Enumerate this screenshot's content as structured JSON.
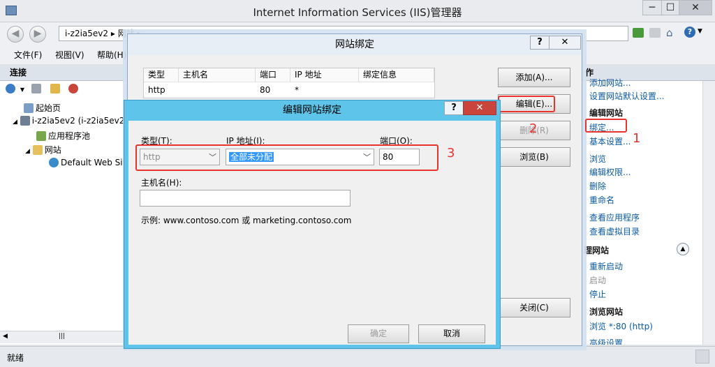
{
  "window": {
    "title": "Internet Information Services (IIS)管理器",
    "min": "─",
    "max": "☐",
    "close": "✕"
  },
  "address": {
    "path": "i-z2ia5ev2  ▸  网站  ▸",
    "back": "◀",
    "forward": "▶"
  },
  "menu": {
    "file": "文件(F)",
    "view": "视图(V)",
    "help": "帮助(H)"
  },
  "left_pane": {
    "header": "连接",
    "tree": [
      "起始页",
      "i-z2ia5ev2 (i-z2ia5ev2\\",
      "应用程序池",
      "网站",
      "Default Web Sit"
    ]
  },
  "right_pane": {
    "header_fragment": "作",
    "items": {
      "add_site": "添加网站...",
      "set_defaults": "设置网站默认设置...",
      "edit_site_header": "编辑网站",
      "bindings": "绑定...",
      "basic_settings": "基本设置...",
      "explore": "浏览",
      "edit_perms": "编辑权限...",
      "remove": "删除",
      "rename": "重命名",
      "view_apps": "查看应用程序",
      "view_vdirs": "查看虚拟目录",
      "manage_header": "理网站",
      "restart": "重新启动",
      "start": "启动",
      "stop": "停止",
      "browse_header": "浏览网站",
      "browse_80": "浏览 *:80 (http)",
      "advanced": "高级设置..."
    }
  },
  "status": {
    "text": "就绪"
  },
  "dialog_bindings": {
    "title": "网站绑定",
    "help": "?",
    "close": "✕",
    "columns": [
      "类型",
      "主机名",
      "端口",
      "IP 地址",
      "绑定信息"
    ],
    "rows": [
      {
        "type": "http",
        "host": "",
        "port": "80",
        "ip": "*",
        "info": ""
      }
    ],
    "buttons": {
      "add": "添加(A)...",
      "edit": "编辑(E)...",
      "remove": "删除(R)",
      "browse": "浏览(B)",
      "close": "关闭(C)"
    }
  },
  "dialog_edit": {
    "title": "编辑网站绑定",
    "help": "?",
    "close": "✕",
    "type_label": "类型(T):",
    "type_value": "http",
    "ip_label": "IP 地址(I):",
    "ip_value": "全部未分配",
    "port_label": "端口(O):",
    "port_value": "80",
    "host_label": "主机名(H):",
    "host_value": "",
    "example": "示例: www.contoso.com 或 marketing.contoso.com",
    "ok": "确定",
    "cancel": "取消"
  },
  "annotations": {
    "n1": "1",
    "n2": "2",
    "n3": "3"
  },
  "colors": {
    "highlight_red": "#e8342c",
    "link_blue": "#0b5aa3",
    "dialog_accent": "#5ec4ea"
  }
}
